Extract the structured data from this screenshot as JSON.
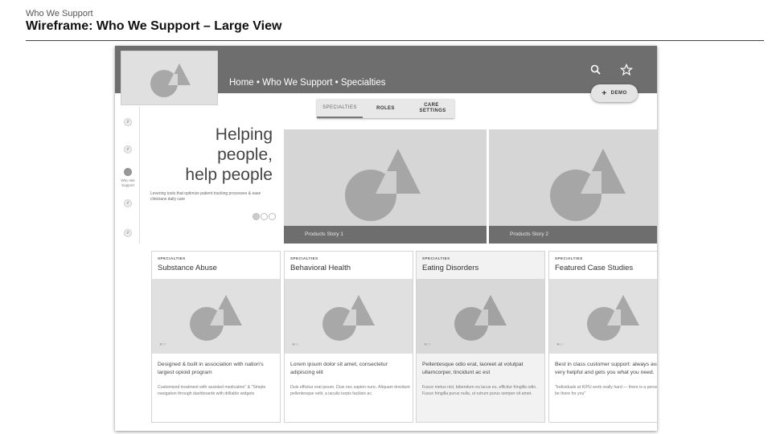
{
  "slide": {
    "kicker": "Who We Support",
    "title": "Wireframe: Who We Support – Large View"
  },
  "header": {
    "breadcrumb": "Home • Who We Support • Specialties",
    "search_icon": "search-icon",
    "star_icon": "star-icon",
    "demo_plus": "+",
    "demo_label": "DEMO"
  },
  "tabs": [
    {
      "label": "SPECIALTIES",
      "active": true
    },
    {
      "label": "ROLES",
      "active": false
    },
    {
      "label": "CARE SETTINGS",
      "active": false
    }
  ],
  "side_rail": {
    "active_label": "Who We Support"
  },
  "hero": {
    "title_line1": "Helping",
    "title_line2": "people,",
    "title_line3": "help people",
    "description": "Levering tools that optimize patient tracking processes & ease clinicians daily care"
  },
  "stories": [
    {
      "label": "Products Story 1"
    },
    {
      "label": "Products Story 2"
    }
  ],
  "cards": [
    {
      "kicker": "SPECIALTIES",
      "title": "Substance Abuse",
      "body": "Designed & built in association with nation's largest opioid program",
      "sub": "Customized treatment  with assisted medication\" & \"Simple navigation through dashboards with drillable widgets"
    },
    {
      "kicker": "SPECIALTIES",
      "title": "Behavioral Health",
      "body": "Lorem ipsum dolor sit amet, consectetur adipiscing elit",
      "sub": "Duis efficitur erat ipsum. Duis nec sapien nunc. Aliquam tincidunt pellentesque velit, a iaculis turpis facilisis ac."
    },
    {
      "kicker": "SPECIALTIES",
      "title": "Eating Disorders",
      "body": "Pellentesque odio erat, laoreet at volutpat ullamcorper, tincidunt ac est",
      "sub": "Fusce metus nisl, bibendum eu lacus eu, efficitur fringilla odio. Fusce fringilla purus nulla, ut rutrum purus semper sit amet."
    },
    {
      "kicker": "SPECIALTIES",
      "title": "Featured Case Studies",
      "body": "Best in class customer support: always available, very helpful and gets you what you need.",
      "sub": "\"Individuals at KIPU work really hard — there is a person will always be there for you\""
    }
  ]
}
